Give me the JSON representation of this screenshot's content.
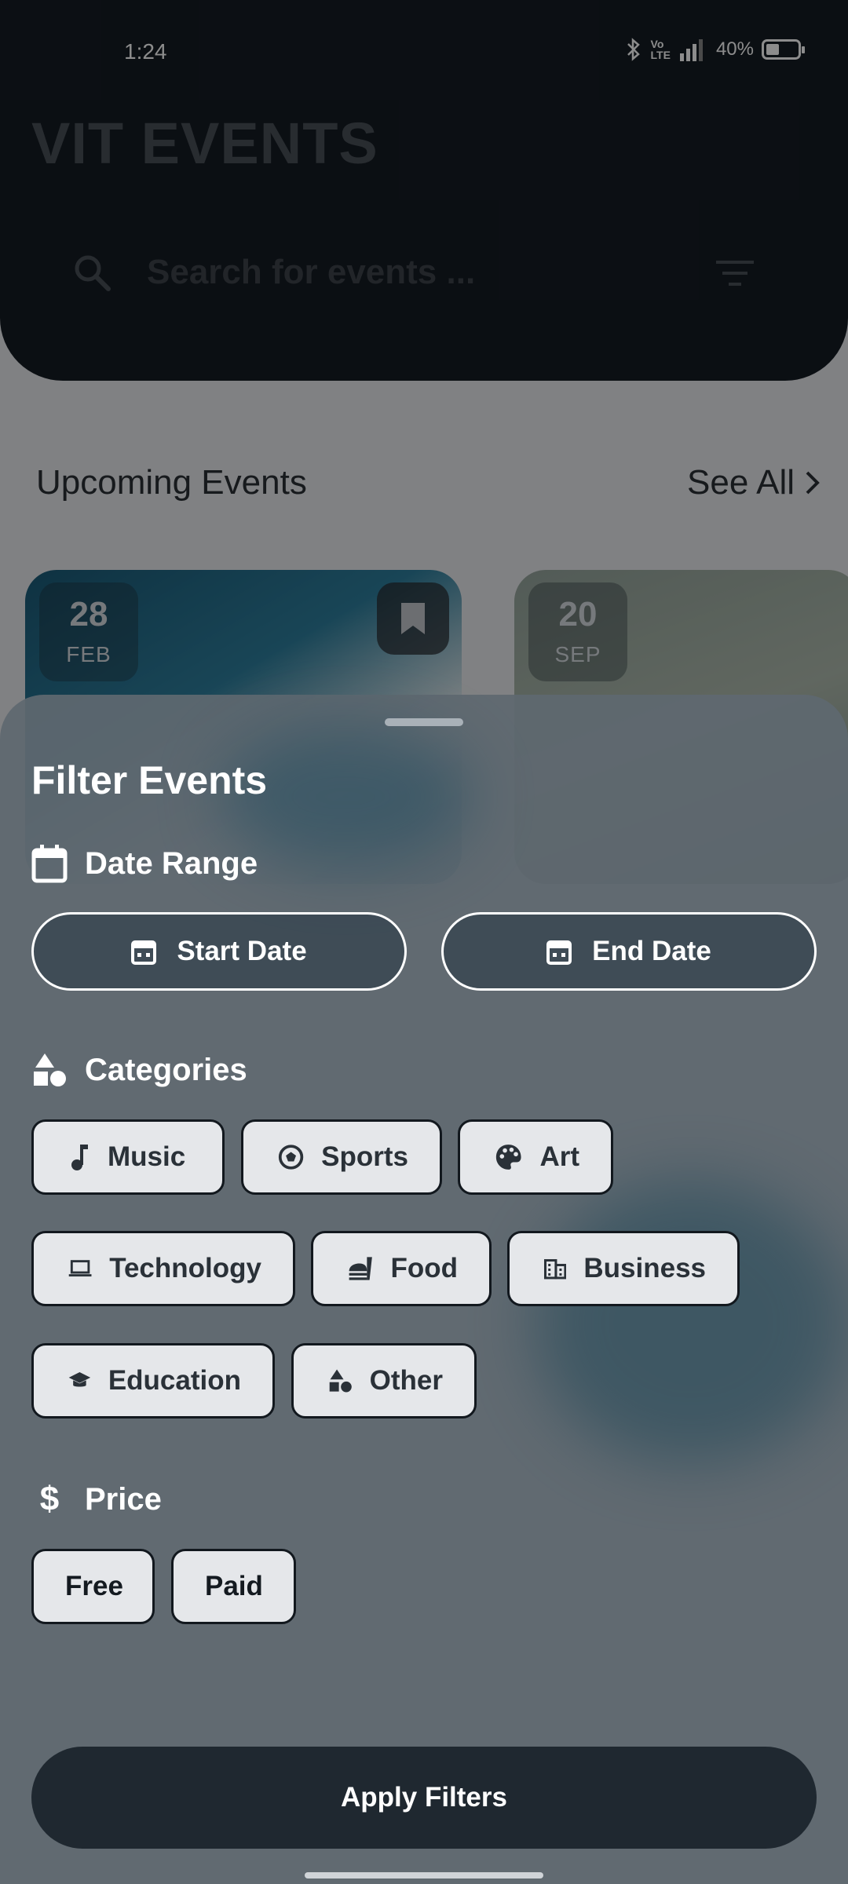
{
  "status_bar": {
    "time": "1:24",
    "battery": "40%"
  },
  "header": {
    "title": "VIT EVENTS",
    "search_placeholder": "Search for events ..."
  },
  "upcoming": {
    "title": "Upcoming Events",
    "see_all": "See All"
  },
  "cards": [
    {
      "day": "28",
      "month": "FEB"
    },
    {
      "day": "20",
      "month": "SEP"
    }
  ],
  "filter": {
    "title": "Filter Events",
    "date_range": {
      "label": "Date Range",
      "start": "Start Date",
      "end": "End Date"
    },
    "categories": {
      "label": "Categories",
      "items": [
        "Music",
        "Sports",
        "Art",
        "Technology",
        "Food",
        "Business",
        "Education",
        "Other"
      ]
    },
    "price": {
      "label": "Price",
      "items": [
        "Free",
        "Paid"
      ]
    },
    "apply": "Apply Filters"
  }
}
